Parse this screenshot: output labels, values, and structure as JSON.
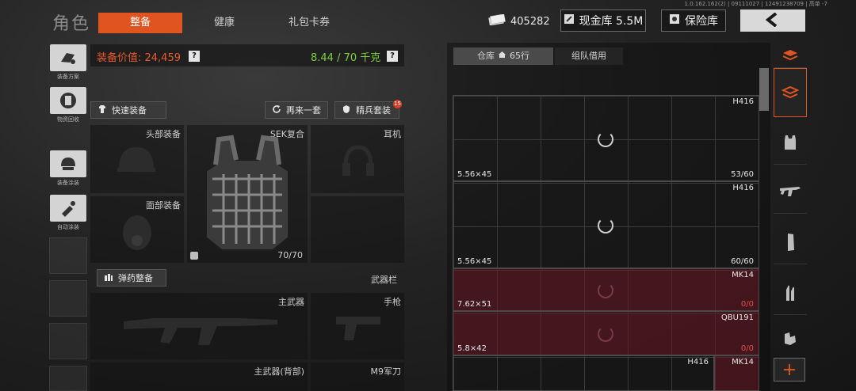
{
  "version": "1.0.162.162(2) | 09111027 | 12491238709 | 高单 -7",
  "page_title": "角色",
  "tabs": [
    {
      "label": "整备",
      "active": true
    },
    {
      "label": "健康",
      "active": false
    },
    {
      "label": "礼包卡券",
      "active": false
    }
  ],
  "currency": {
    "amount": "405282"
  },
  "cash_vault": {
    "label": "现金库 5.5M"
  },
  "safe": {
    "label": "保险库"
  },
  "side_buttons": [
    {
      "label": "装备方案",
      "icon": "loadout-icon"
    },
    {
      "label": "物资回收",
      "icon": "recycle-icon"
    },
    {
      "label": "装备涂装",
      "icon": "helmet-skin-icon"
    },
    {
      "label": "自动涂装",
      "icon": "spray-brush-icon"
    }
  ],
  "equipment": {
    "value_label": "装备价值: 24,459",
    "weight_label": "8.44 / 70 千克",
    "help": "?",
    "quick_equip": "快速装备",
    "repeat_set": "再来一套",
    "elite_set": "精兵套装",
    "elite_badge": "15",
    "ammo_button": "弹药整备",
    "weapons_bar": "武器栏"
  },
  "slots": {
    "head": "头部装备",
    "face": "面部装备",
    "armor_name": "SEK复合",
    "armor_durability": "70/70",
    "headset": "耳机",
    "primary": "主武器",
    "pistol": "手枪",
    "primary_back": "主武器(背部)",
    "melee": "M9军刀"
  },
  "storage": {
    "tab_warehouse": "仓库",
    "tab_rows": "65行",
    "tab_team": "组队借用"
  },
  "items": [
    {
      "name": "H416",
      "caliber": "5.56×45",
      "count": "53/60",
      "empty": false
    },
    {
      "name": "H416",
      "caliber": "5.56×45",
      "count": "60/60",
      "empty": false
    },
    {
      "name": "MK14",
      "caliber": "7.62×51",
      "count": "0/0",
      "empty": true
    },
    {
      "name": "QBU191",
      "caliber": "5.8×42",
      "count": "0/0",
      "empty": true
    }
  ],
  "bottom_items": {
    "left": "H416",
    "right": "MK14"
  },
  "categories": [
    "all-icon",
    "armor-vest-icon",
    "rifle-icon",
    "magazine-icon",
    "bullet-icon",
    "gear-icon"
  ],
  "add_label": "+",
  "colors": {
    "accent": "#e0541f",
    "value": "#e85a2a",
    "weight": "#7ed13a",
    "empty_count": "#e05050"
  }
}
